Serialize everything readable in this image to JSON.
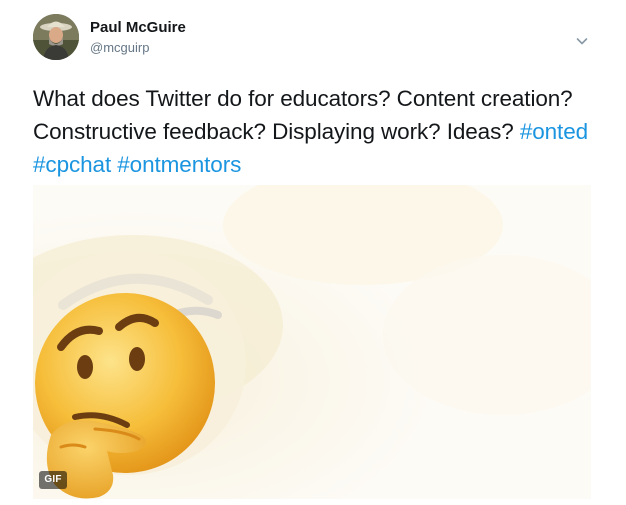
{
  "author": {
    "name": "Paul McGuire",
    "handle": "@mcguirp",
    "avatar_icon": "profile-photo-icon"
  },
  "menu": {
    "icon": "chevron-down-icon"
  },
  "tweet": {
    "text_plain": "What does Twitter do for educators? Content creation? Constructive feedback? Displaying work? Ideas?",
    "hashtags": [
      "#onted",
      "#cpchat",
      "#ontmentors"
    ]
  },
  "media": {
    "type": "gif",
    "badge_label": "GIF",
    "icon": "thinking-face-icon"
  },
  "colors": {
    "link": "#1b95e0",
    "text": "#14171a",
    "secondary": "#657786"
  }
}
